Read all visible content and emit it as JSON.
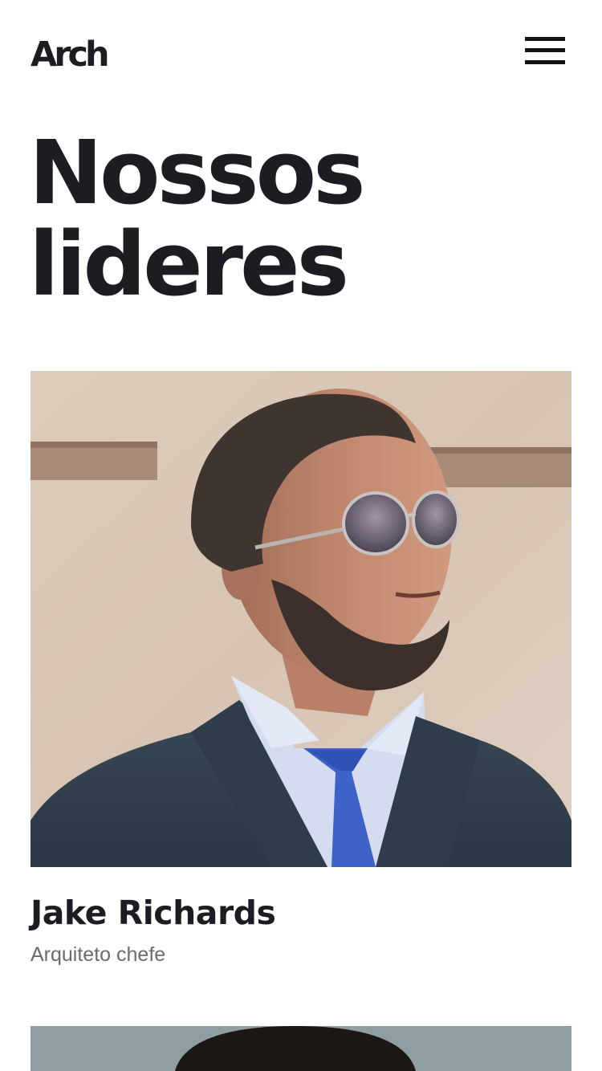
{
  "header": {
    "logo_text": "Arch",
    "menu_icon": "hamburger-menu-icon"
  },
  "main": {
    "title_line1": "Nossos",
    "title_line2": "lideres",
    "leaders": [
      {
        "name": "Jake Richards",
        "role": "Arquiteto chefe"
      }
    ]
  },
  "colors": {
    "text": "#1c1c22",
    "muted": "#6a6a70",
    "background": "#ffffff"
  }
}
